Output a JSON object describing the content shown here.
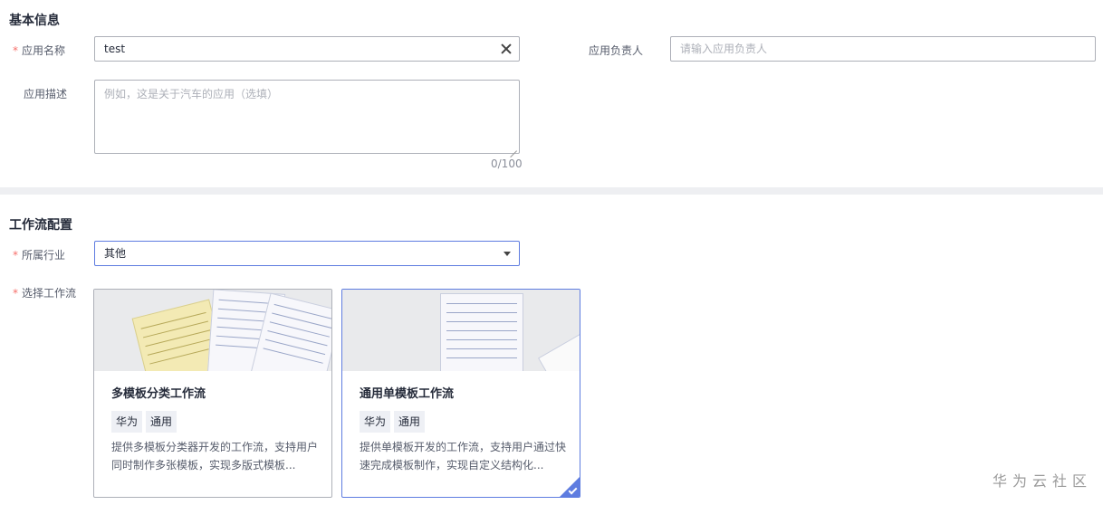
{
  "basic": {
    "section_title": "基本信息",
    "app_name_label": "应用名称",
    "app_name_value": "test",
    "owner_label": "应用负责人",
    "owner_placeholder": "请输入应用负责人",
    "desc_label": "应用描述",
    "desc_placeholder": "例如，这是关于汽车的应用（选填）",
    "desc_counter": "0/100"
  },
  "workflow": {
    "section_title": "工作流配置",
    "industry_label": "所属行业",
    "industry_value": "其他",
    "select_label": "选择工作流",
    "cards": [
      {
        "title": "多模板分类工作流",
        "tags": [
          "华为",
          "通用"
        ],
        "description": "提供多模板分类器开发的工作流，支持用户同时制作多张模板，实现多版式模板...",
        "selected": false
      },
      {
        "title": "通用单模板工作流",
        "tags": [
          "华为",
          "通用"
        ],
        "description": "提供单模板开发的工作流，支持用户通过快速完成模板制作，实现自定义结构化...",
        "selected": true
      }
    ]
  },
  "required_mark": "*",
  "watermark": "华为云社区",
  "colors": {
    "accent": "#5e7ce0",
    "required": "#f66f6a",
    "divider": "#eeeff2"
  },
  "icons": {
    "clear": "close-icon",
    "dropdown": "chevron-down-icon",
    "selected": "check-icon"
  }
}
